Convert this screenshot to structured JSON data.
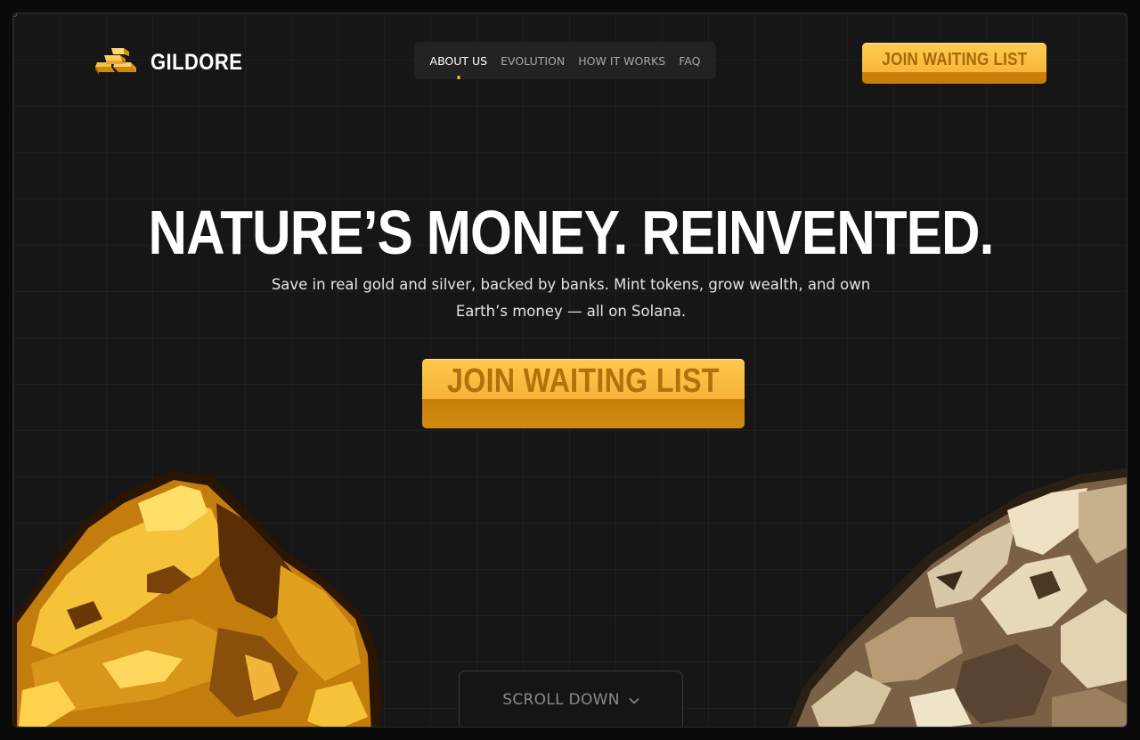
{
  "brand": {
    "name": "GILDORE",
    "logo_icon": "gold-bars-icon"
  },
  "nav": {
    "items": [
      {
        "label": "ABOUT US",
        "active": true
      },
      {
        "label": "EVOLUTION",
        "active": false
      },
      {
        "label": "HOW IT WORKS",
        "active": false
      },
      {
        "label": "FAQ",
        "active": false
      }
    ]
  },
  "header": {
    "cta_label": "JOIN WAITING LIST"
  },
  "hero": {
    "title": "NATURE’S MONEY. REINVENTED.",
    "subtitle": "Save in real gold and silver, backed by banks. Mint tokens, grow wealth, and own Earth’s money — all on Solana.",
    "cta_label": "JOIN WAITING LIST"
  },
  "scroll": {
    "label": "SCROLL DOWN",
    "icon": "chevron-down-icon"
  },
  "colors": {
    "accent": "#f7b73a",
    "background": "#161616",
    "gold": "#e6a51c",
    "silver": "#c9b89a"
  }
}
